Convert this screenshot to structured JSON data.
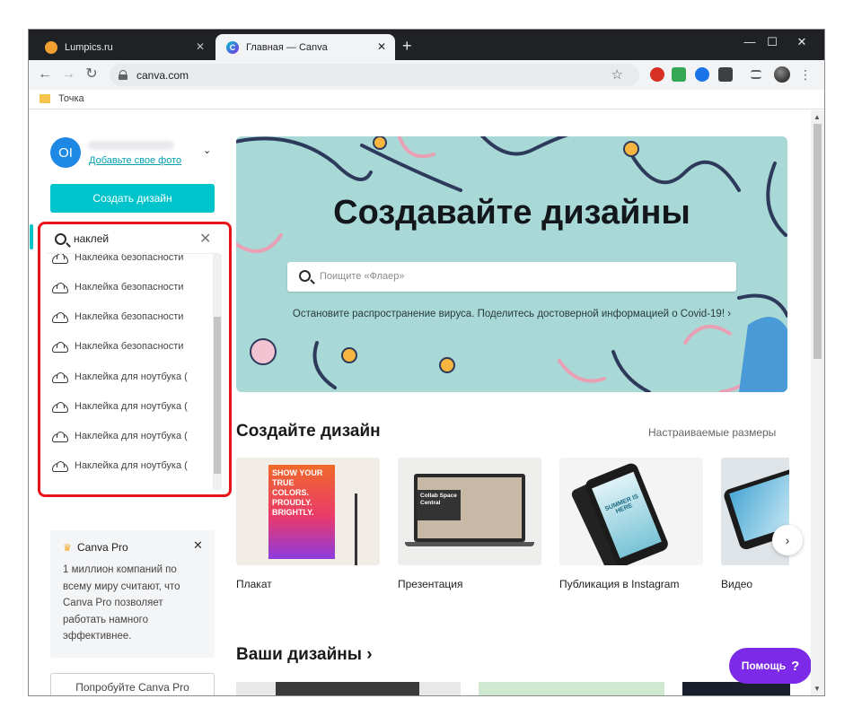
{
  "browser": {
    "tabs": [
      {
        "title": "Lumpics.ru",
        "active": false
      },
      {
        "title": "Главная — Canva",
        "active": true
      }
    ],
    "new_tab_symbol": "+",
    "close_symbol": "✕",
    "window_controls": {
      "minimize": "—",
      "maximize": "☐",
      "close": "✕"
    },
    "nav": {
      "back": "←",
      "forward": "→",
      "reload": "↻"
    },
    "url": "canva.com",
    "star": "☆",
    "menu": "⋮",
    "bookmarks": [
      {
        "label": "Точка"
      }
    ]
  },
  "sidebar": {
    "avatar_initials": "OI",
    "add_photo": "Добавьте свое фото",
    "chevron": "⌄",
    "create_button": "Создать дизайн",
    "search": {
      "query": "наклей",
      "clear": "✕",
      "suggestions": [
        "Наклейка безопасности",
        "Наклейка безопасности",
        "Наклейка безопасности",
        "Наклейка безопасности",
        "Наклейка для ноутбука (",
        "Наклейка для ноутбука (",
        "Наклейка для ноутбука (",
        "Наклейка для ноутбука ("
      ]
    },
    "pro_card": {
      "crown": "♛",
      "title": "Canva Pro",
      "close": "✕",
      "text": "1 миллион компаний по всему миру считают, что Canva Pro позволяет работать намного эффективнее."
    },
    "try_pro_button": "Попробуйте Canva Pro"
  },
  "hero": {
    "title": "Создавайте дизайны",
    "search_placeholder": "Поищите «Флаер»",
    "note": "Остановите распространение вируса. Поделитесь достоверной информацией о Covid-19! ›"
  },
  "create_section": {
    "title": "Создайте дизайн",
    "custom_sizes": "Настраиваемые размеры",
    "cards": [
      {
        "label": "Плакат",
        "thumb_text": "SHOW YOUR TRUE COLORS. PROUDLY. BRIGHTLY."
      },
      {
        "label": "Презентация",
        "thumb_text": "Collab Space Central"
      },
      {
        "label": "Публикация в Instagram",
        "thumb_text": "SUMMER IS HERE"
      },
      {
        "label": "Видео",
        "thumb_text": ""
      }
    ],
    "next_arrow": "›"
  },
  "your_designs": {
    "title": "Ваши дизайны ›"
  },
  "help_button": {
    "label": "Помощь",
    "icon": "?"
  },
  "colors": {
    "accent": "#00c4cc",
    "hero_bg": "#a9d9d6",
    "help": "#7d2ae8",
    "highlight_frame": "#e8141b"
  }
}
